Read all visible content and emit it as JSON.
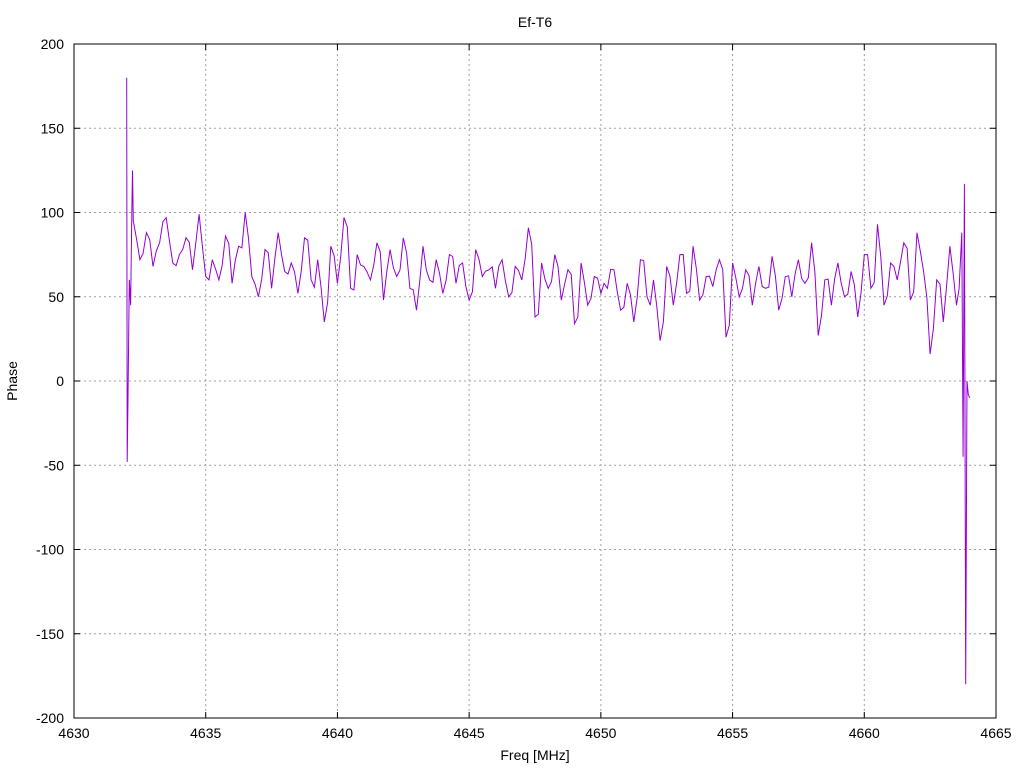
{
  "chart_data": {
    "type": "line",
    "title": "Ef-T6",
    "xlabel": "Freq [MHz]",
    "ylabel": "Phase",
    "xlim": [
      4630,
      4665
    ],
    "ylim": [
      -200,
      200
    ],
    "xticks": [
      4630,
      4635,
      4640,
      4645,
      4650,
      4655,
      4660,
      4665
    ],
    "yticks": [
      -200,
      -150,
      -100,
      -50,
      0,
      50,
      100,
      150,
      200
    ],
    "grid": true,
    "series": [
      {
        "name": "Phase",
        "color": "#9400d3",
        "x_start_points": [
          4632.0,
          4632.02,
          4632.05,
          4632.1,
          4632.15,
          4632.2,
          4632.22
        ],
        "y_start_points": [
          180,
          -48,
          -10,
          60,
          45,
          107,
          125
        ],
        "regular_x_start": 4632.25,
        "regular_x_step": 0.25,
        "regular_y": [
          95,
          72,
          88,
          68,
          82,
          97,
          70,
          75,
          85,
          66,
          99,
          62,
          72,
          60,
          86,
          58,
          80,
          100,
          62,
          50,
          78,
          55,
          88,
          65,
          70,
          52,
          85,
          60,
          72,
          35,
          80,
          58,
          97,
          55,
          75,
          68,
          60,
          82,
          48,
          78,
          62,
          85,
          55,
          42,
          80,
          60,
          72,
          52,
          75,
          58,
          70,
          48,
          78,
          62,
          66,
          55,
          72,
          50,
          68,
          60,
          91,
          38,
          70,
          55,
          75,
          48,
          66,
          34,
          70,
          45,
          62,
          52,
          55,
          66,
          42,
          58,
          35,
          72,
          50,
          60,
          24,
          68,
          45,
          75,
          52,
          80,
          48,
          62,
          56,
          72,
          26,
          70,
          50,
          66,
          45,
          68,
          55,
          74,
          42,
          62,
          50,
          72,
          58,
          82,
          27,
          60,
          45,
          70,
          50,
          65,
          38,
          75,
          55,
          93,
          45,
          70,
          60,
          82,
          48,
          88,
          65,
          16,
          60,
          35,
          80,
          45
        ],
        "x_end_points": [
          4663.7,
          4663.75,
          4663.8,
          4663.85,
          4663.9,
          4664.0
        ],
        "y_end_points": [
          88,
          -45,
          117,
          -180,
          0,
          -10
        ]
      }
    ]
  }
}
